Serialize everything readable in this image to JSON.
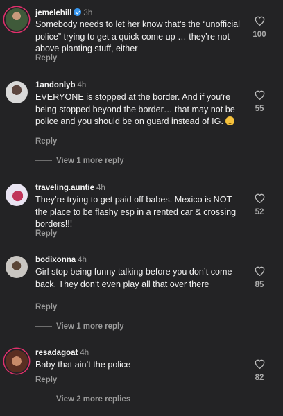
{
  "comments": [
    {
      "username": "jemelehill",
      "time": "3h",
      "verified": true,
      "text": "Somebody needs to let her know that’s the “unofficial police” trying to get a quick come up … they’re not above planting stuff, either",
      "reply_label": "Reply",
      "likes": "100",
      "avatar_colors": [
        "#b9c9a6",
        "#3f5a3a"
      ]
    },
    {
      "username": "1andonlyb",
      "time": "4h",
      "verified": false,
      "text": "EVERYONE is stopped at the border. And if you’re being stopped beyond the border… that may not be police and you should be on guard instead of IG.",
      "emoji": "face-with-hand-over-mouth",
      "reply_label": "Reply",
      "likes": "55",
      "view_more": "View 1 more reply",
      "avatar_colors": [
        "#d9d9d9",
        "#4a3a36"
      ]
    },
    {
      "username": "traveling.auntie",
      "time": "4h",
      "verified": false,
      "text": "They’re trying to get paid off babes. Mexico is NOT the place to be flashy esp in a rented car & crossing borders!!!",
      "reply_label": "Reply",
      "likes": "52",
      "avatar_colors": [
        "#e9e4f2",
        "#c0345a"
      ]
    },
    {
      "username": "bodixonna",
      "time": "4h",
      "verified": false,
      "text": "Girl stop being funny talking before you don’t come back. They don’t even play all that over there",
      "reply_label": "Reply",
      "likes": "85",
      "view_more": "View 1 more reply",
      "avatar_colors": [
        "#c9c6c2",
        "#5a4536"
      ]
    },
    {
      "username": "resadagoat",
      "time": "4h",
      "verified": false,
      "text": "Baby that ain’t the police",
      "reply_label": "Reply",
      "likes": "82",
      "view_more": "View 2 more replies",
      "avatar_colors": [
        "#c98b6a",
        "#5a2e22"
      ]
    }
  ]
}
